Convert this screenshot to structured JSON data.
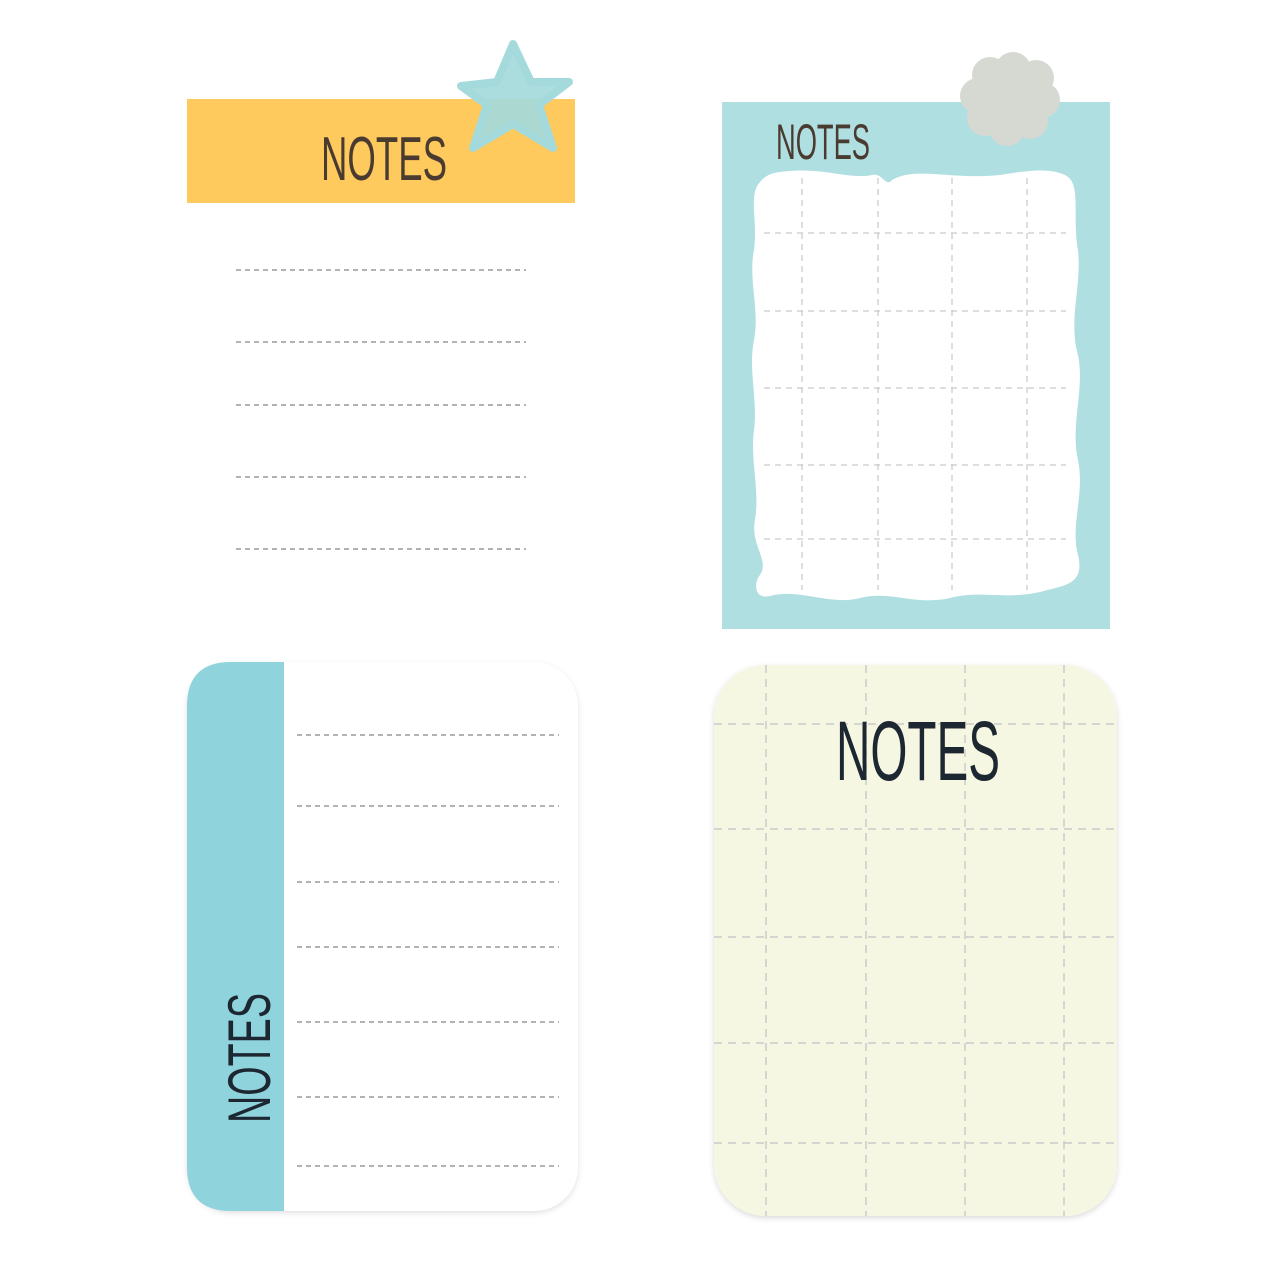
{
  "colors": {
    "background": "#ffffff",
    "orange": "#fec95d",
    "star": "#a4dadb",
    "light_blue": "#b0dfe2",
    "flower": "#d6d9d2",
    "tab_blue": "#8fd3dc",
    "cream": "#f6f7e2",
    "title_dark": "#4a3b31",
    "title_navy": "#1d2731",
    "dash_line": "#9a9a9a",
    "grid_line": "#c9c9c9"
  },
  "notes": [
    {
      "title": "NOTES",
      "style": "orange-header-lined",
      "decoration": "star-icon",
      "line_count": 5
    },
    {
      "title": "NOTES",
      "style": "blue-frame-grid",
      "decoration": "flower-icon",
      "grid": {
        "columns": 5,
        "rows": 6
      }
    },
    {
      "title": "NOTES",
      "style": "blue-side-tab-lined",
      "line_count": 7
    },
    {
      "title": "NOTES",
      "style": "cream-grid-card",
      "grid": {
        "columns": 5,
        "rows": 6
      }
    }
  ]
}
